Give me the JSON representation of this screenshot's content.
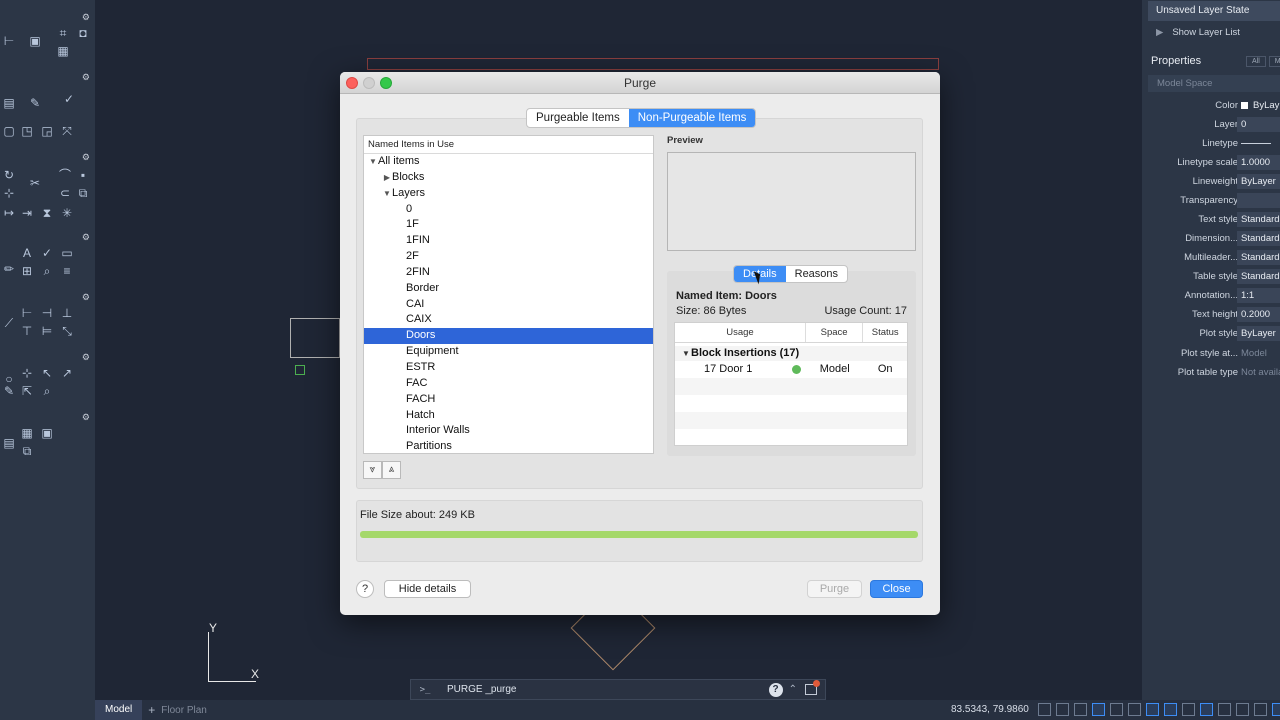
{
  "dialog": {
    "title": "Purge",
    "tabs": [
      "Purgeable Items",
      "Non-Purgeable Items"
    ],
    "active_tab": "Non-Purgeable Items",
    "tree": {
      "header": "Named Items in Use",
      "root": "All items",
      "blocks": "Blocks",
      "layers": "Layers",
      "layer_items": [
        "0",
        "1F",
        "1FIN",
        "2F",
        "2FIN",
        "Border",
        "CAI",
        "CAIX",
        "Doors",
        "Equipment",
        "ESTR",
        "FAC",
        "FACH",
        "Hatch",
        "Interior Walls",
        "Partitions"
      ],
      "selected": "Doors"
    },
    "preview_label": "Preview",
    "detail_tabs": [
      "Details",
      "Reasons"
    ],
    "active_detail_tab": "Details",
    "named_item": "Named Item: Doors",
    "size": "Size: 86 Bytes",
    "usage_count": "Usage Count: 17",
    "usage_table": {
      "columns": [
        "Usage",
        "Space",
        "Status"
      ],
      "group": "Block Insertions (17)",
      "rows": [
        {
          "usage": "17 Door 1",
          "space": "Model",
          "status": "On"
        }
      ]
    },
    "file_size": "File Size about: 249 KB",
    "progress": 1.0,
    "buttons": {
      "help": "?",
      "hide_details": "Hide details",
      "purge": "Purge",
      "close": "Close"
    }
  },
  "command_line": {
    "prompt": ">_",
    "text": "PURGE _purge",
    "help": "?"
  },
  "status_bar": {
    "model_tab": "Model",
    "add": "+",
    "layout_tab": "Floor Plan",
    "coords": "83.5343, 79.9860"
  },
  "right_panel": {
    "layer_state": "Unsaved Layer State",
    "show_layer_list": "Show Layer List",
    "properties_title": "Properties",
    "tabs": [
      "All",
      "M"
    ],
    "model_space": "Model Space",
    "rows": [
      {
        "key": "Color",
        "value": "ByLay"
      },
      {
        "key": "Layer",
        "value": "0"
      },
      {
        "key": "Linetype",
        "value": ""
      },
      {
        "key": "Linetype scale",
        "value": "1.0000"
      },
      {
        "key": "Lineweight",
        "value": "ByLayer"
      },
      {
        "key": "Transparency",
        "value": ""
      },
      {
        "key": "Text style",
        "value": "Standard"
      },
      {
        "key": "Dimension...",
        "value": "Standard"
      },
      {
        "key": "Multileader...",
        "value": "Standard"
      },
      {
        "key": "Table style",
        "value": "Standard"
      },
      {
        "key": "Annotation...",
        "value": "1:1"
      },
      {
        "key": "Text height",
        "value": "0.2000"
      },
      {
        "key": "Plot style",
        "value": "ByLayer"
      },
      {
        "key": "Plot style at...",
        "value": "Model"
      },
      {
        "key": "Plot table type",
        "value": "Not availa"
      }
    ]
  },
  "ucs": {
    "x": "X",
    "y": "Y"
  },
  "colors": {
    "accent": "#3d8df5",
    "selection": "#2e65d8",
    "progress": "#a5d86a"
  }
}
